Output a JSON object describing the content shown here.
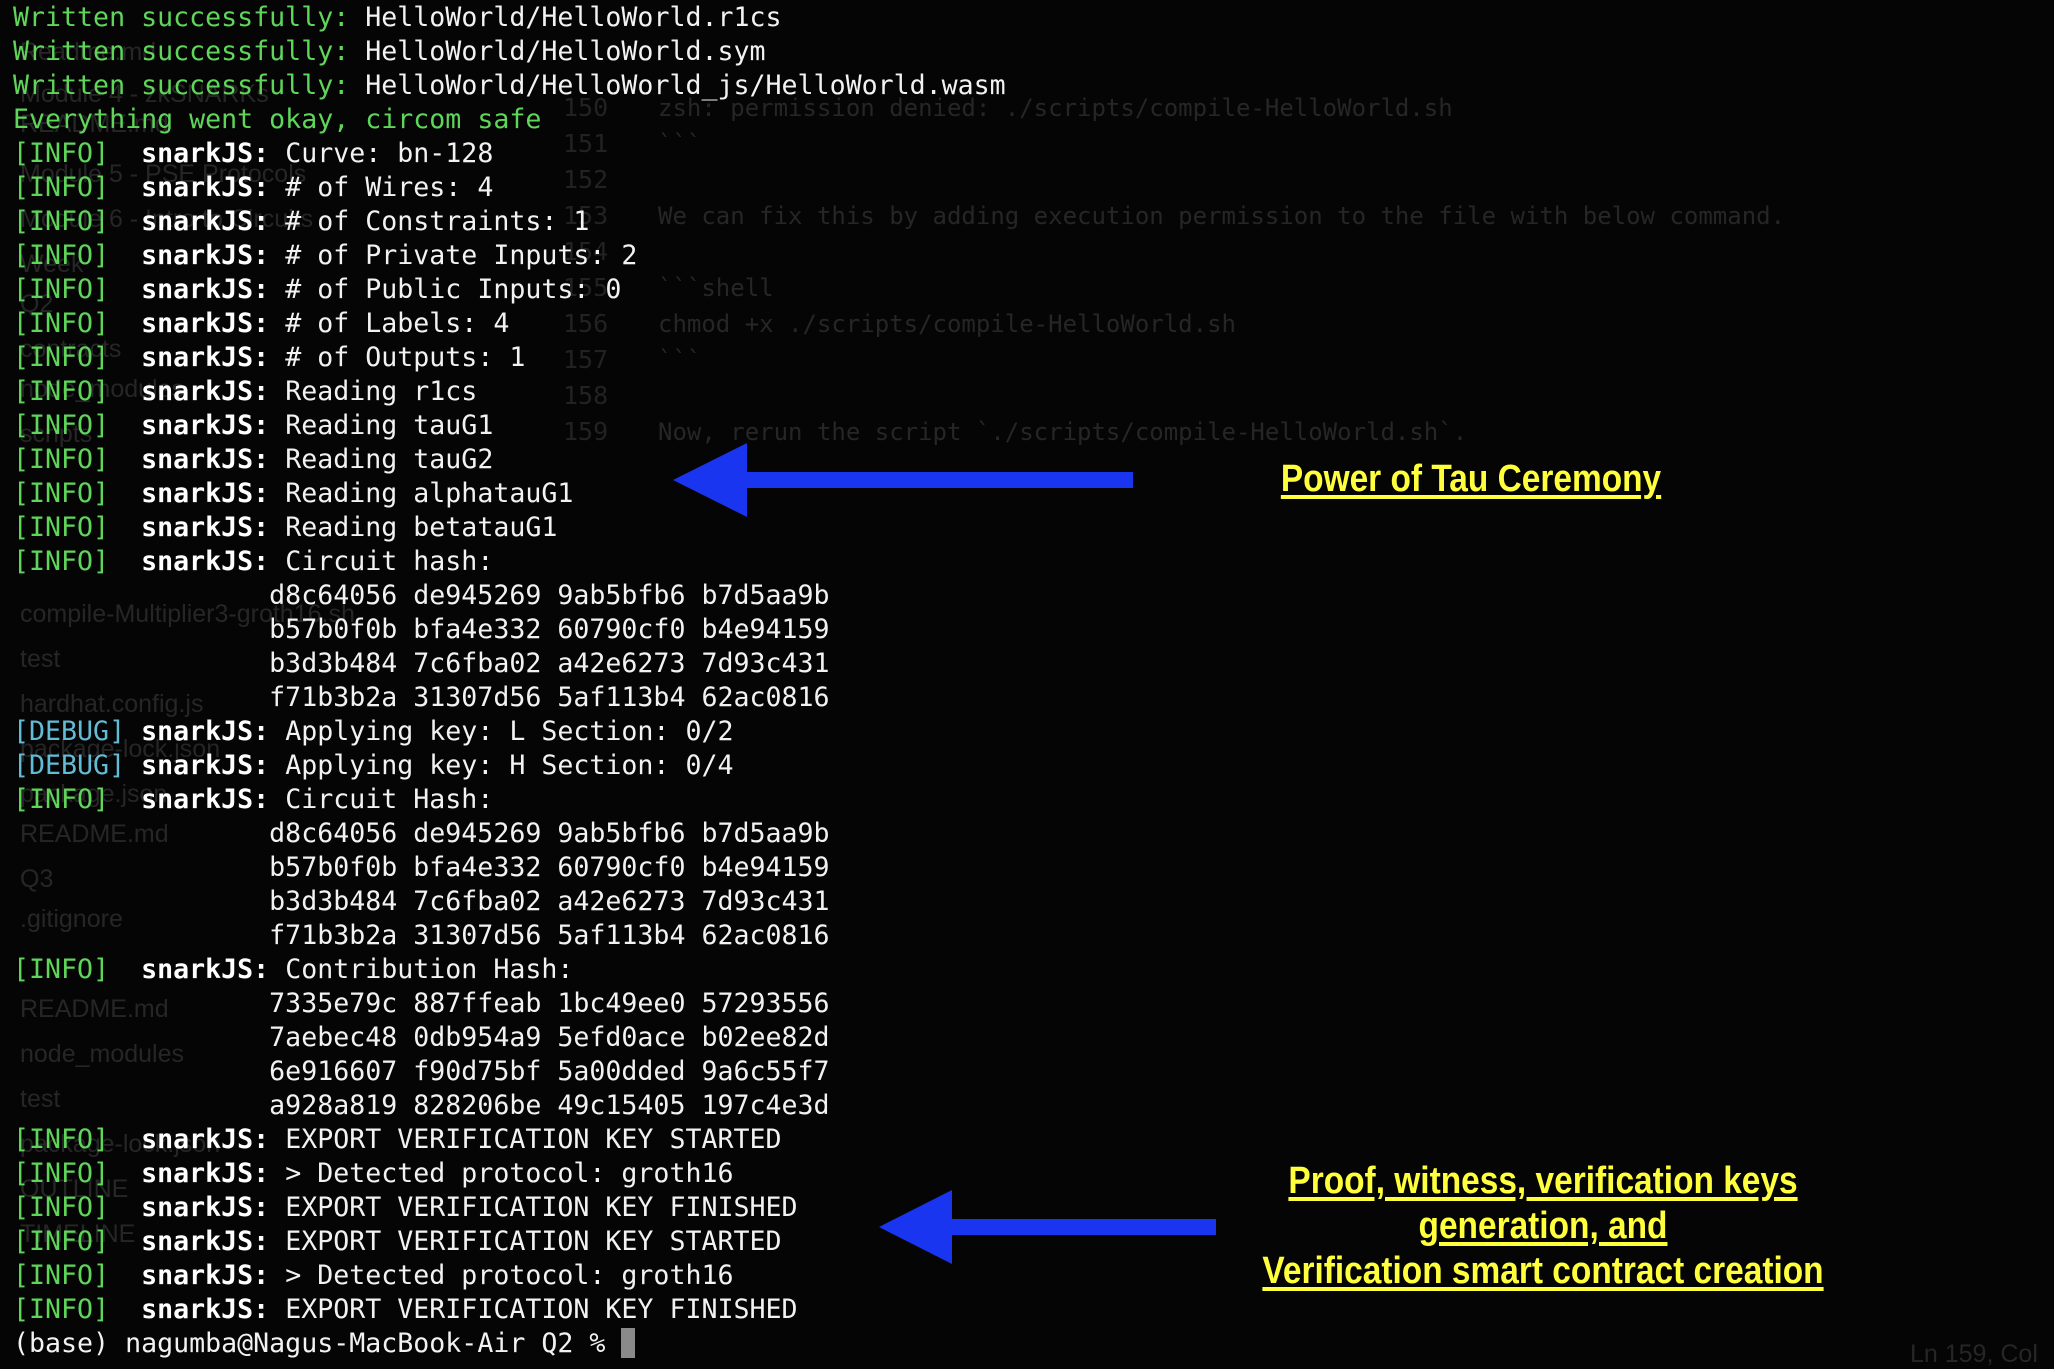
{
  "background_editor": {
    "sidebar_items": [
      "Readme.md",
      "Module 4 - zkSNARKs",
      "README.md",
      "Module 5 - PSE Protocols",
      "Module 6 - Intro to Circuits",
      "Week",
      "Q2",
      "contracts",
      "node_modules",
      "scripts",
      "compile-Multiplier3-groth16.sh",
      "test",
      "hardhat.config.js",
      "package-lock.json",
      "package.json",
      "README.md",
      "Q3",
      ".gitignore",
      "README.md",
      "node_modules",
      "test",
      "package-lock.json",
      "OUTLINE",
      "TIMELINE"
    ],
    "line_numbers": [
      "150",
      "151",
      "152",
      "153",
      "154",
      "155",
      "156",
      "157",
      "158",
      "159"
    ],
    "code_lines": [
      "zsh: permission denied: ./scripts/compile-HelloWorld.sh",
      "```",
      "",
      "We can fix this by adding execution permission to the file with below command.",
      "",
      "```shell",
      "chmod +x ./scripts/compile-HelloWorld.sh",
      "```",
      "",
      "Now, rerun the script `./scripts/compile-HelloWorld.sh`."
    ],
    "status_bar": "Ln 159, Col"
  },
  "terminal": {
    "lines": [
      {
        "segments": [
          {
            "text": "Written successfully: ",
            "style": "green"
          },
          {
            "text": "HelloWorld/HelloWorld.r1cs",
            "style": "white"
          }
        ]
      },
      {
        "segments": [
          {
            "text": "Written successfully: ",
            "style": "green"
          },
          {
            "text": "HelloWorld/HelloWorld.sym",
            "style": "white"
          }
        ]
      },
      {
        "segments": [
          {
            "text": "Written successfully: ",
            "style": "green"
          },
          {
            "text": "HelloWorld/HelloWorld_js/HelloWorld.wasm",
            "style": "white"
          }
        ]
      },
      {
        "segments": [
          {
            "text": "Everything went okay, circom safe",
            "style": "green"
          }
        ]
      },
      {
        "tag": "[INFO]",
        "source": "snarkJS:",
        "text": "Curve: bn-128"
      },
      {
        "tag": "[INFO]",
        "source": "snarkJS:",
        "text": "# of Wires: 4"
      },
      {
        "tag": "[INFO]",
        "source": "snarkJS:",
        "text": "# of Constraints: 1"
      },
      {
        "tag": "[INFO]",
        "source": "snarkJS:",
        "text": "# of Private Inputs: 2"
      },
      {
        "tag": "[INFO]",
        "source": "snarkJS:",
        "text": "# of Public Inputs: 0"
      },
      {
        "tag": "[INFO]",
        "source": "snarkJS:",
        "text": "# of Labels: 4"
      },
      {
        "tag": "[INFO]",
        "source": "snarkJS:",
        "text": "# of Outputs: 1"
      },
      {
        "tag": "[INFO]",
        "source": "snarkJS:",
        "text": "Reading r1cs"
      },
      {
        "tag": "[INFO]",
        "source": "snarkJS:",
        "text": "Reading tauG1"
      },
      {
        "tag": "[INFO]",
        "source": "snarkJS:",
        "text": "Reading tauG2"
      },
      {
        "tag": "[INFO]",
        "source": "snarkJS:",
        "text": "Reading alphatauG1"
      },
      {
        "tag": "[INFO]",
        "source": "snarkJS:",
        "text": "Reading betatauG1"
      },
      {
        "tag": "[INFO]",
        "source": "snarkJS:",
        "text": "Circuit hash:"
      },
      {
        "hash": "d8c64056 de945269 9ab5bfb6 b7d5aa9b"
      },
      {
        "hash": "b57b0f0b bfa4e332 60790cf0 b4e94159"
      },
      {
        "hash": "b3d3b484 7c6fba02 a42e6273 7d93c431"
      },
      {
        "hash": "f71b3b2a 31307d56 5af113b4 62ac0816"
      },
      {
        "tag": "[DEBUG]",
        "source": "snarkJS:",
        "text": "Applying key: L Section: 0/2"
      },
      {
        "tag": "[DEBUG]",
        "source": "snarkJS:",
        "text": "Applying key: H Section: 0/4"
      },
      {
        "tag": "[INFO]",
        "source": "snarkJS:",
        "text": "Circuit Hash:"
      },
      {
        "hash": "d8c64056 de945269 9ab5bfb6 b7d5aa9b"
      },
      {
        "hash": "b57b0f0b bfa4e332 60790cf0 b4e94159"
      },
      {
        "hash": "b3d3b484 7c6fba02 a42e6273 7d93c431"
      },
      {
        "hash": "f71b3b2a 31307d56 5af113b4 62ac0816"
      },
      {
        "tag": "[INFO]",
        "source": "snarkJS:",
        "text": "Contribution Hash:"
      },
      {
        "hash": "7335e79c 887ffeab 1bc49ee0 57293556"
      },
      {
        "hash": "7aebec48 0db954a9 5efd0ace b02ee82d"
      },
      {
        "hash": "6e916607 f90d75bf 5a00dded 9a6c55f7"
      },
      {
        "hash": "a928a819 828206be 49c15405 197c4e3d"
      },
      {
        "tag": "[INFO]",
        "source": "snarkJS:",
        "text": "EXPORT VERIFICATION KEY STARTED"
      },
      {
        "tag": "[INFO]",
        "source": "snarkJS:",
        "text": "> Detected protocol: groth16"
      },
      {
        "tag": "[INFO]",
        "source": "snarkJS:",
        "text": "EXPORT VERIFICATION KEY FINISHED"
      },
      {
        "tag": "[INFO]",
        "source": "snarkJS:",
        "text": "EXPORT VERIFICATION KEY STARTED"
      },
      {
        "tag": "[INFO]",
        "source": "snarkJS:",
        "text": "> Detected protocol: groth16"
      },
      {
        "tag": "[INFO]",
        "source": "snarkJS:",
        "text": "EXPORT VERIFICATION KEY FINISHED"
      }
    ],
    "prompt": "(base) nagumba@Nagus-MacBook-Air Q2 % "
  },
  "annotations": {
    "power_of_tau": "Power of Tau Ceremony",
    "proof_lines": [
      "Proof, witness, verification keys",
      "generation, and",
      "Verification smart contract creation"
    ],
    "arrow_color": "#1a35f0",
    "text_color": "#ffff3c"
  },
  "colors": {
    "info": "#5fd65a",
    "debug": "#62bcd6",
    "background": "#050505"
  }
}
